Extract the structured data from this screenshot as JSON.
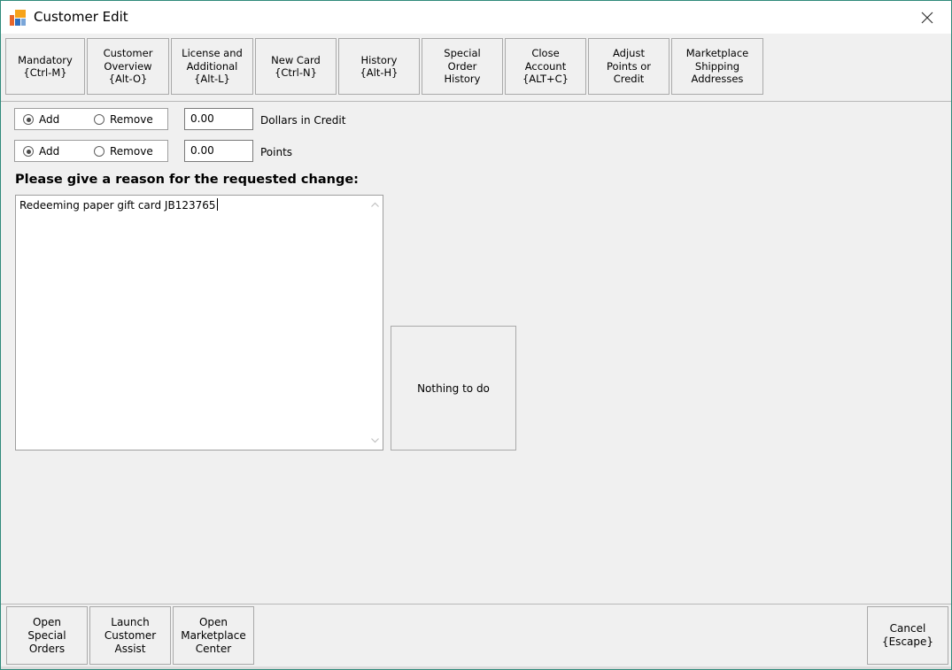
{
  "window": {
    "title": "Customer Edit",
    "icon": "app-logo-icon",
    "close_icon": "close-icon"
  },
  "tabs": [
    {
      "label": "Mandatory\n{Ctrl-M}"
    },
    {
      "label": "Customer\nOverview\n{Alt-O}"
    },
    {
      "label": "License and\nAdditional\n{Alt-L}"
    },
    {
      "label": "New Card\n{Ctrl-N}"
    },
    {
      "label": "History\n{Alt-H}"
    },
    {
      "label": "Special\nOrder\nHistory"
    },
    {
      "label": "Close\nAccount\n{ALT+C}"
    },
    {
      "label": "Adjust\nPoints or\nCredit"
    },
    {
      "label": "Marketplace\nShipping\nAddresses"
    }
  ],
  "credit": {
    "add_label": "Add",
    "remove_label": "Remove",
    "selected": "Add",
    "value": "0.00",
    "label": "Dollars in Credit"
  },
  "points": {
    "add_label": "Add",
    "remove_label": "Remove",
    "selected": "Add",
    "value": "0.00",
    "label": "Points"
  },
  "reason": {
    "prompt": "Please give a reason for the requested change:",
    "text": "Redeeming paper gift card JB123765"
  },
  "status_button": "Nothing to do",
  "bottom_buttons": [
    {
      "label": "Open\nSpecial\nOrders"
    },
    {
      "label": "Launch\nCustomer\nAssist"
    },
    {
      "label": "Open\nMarketplace\nCenter"
    }
  ],
  "cancel_button": "Cancel\n{Escape}",
  "colors": {
    "window_border": "#2f8a7b",
    "background": "#f0f0f0"
  }
}
